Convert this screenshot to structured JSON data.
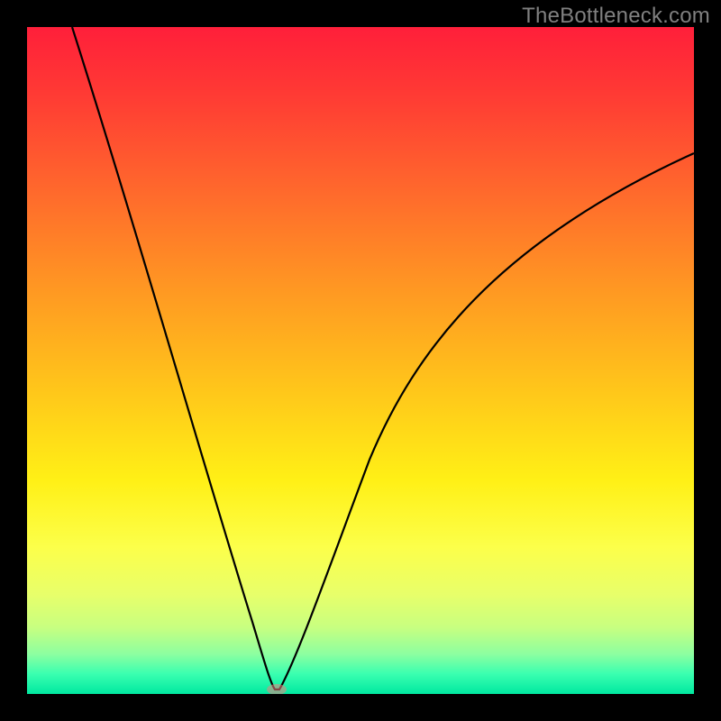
{
  "watermark": "TheBottleneck.com",
  "colors": {
    "frame": "#000000",
    "curve": "#000000",
    "marker": "#f08080",
    "gradient_top": "#ff1f3a",
    "gradient_bottom": "#00e8a0"
  },
  "chart_data": {
    "type": "line",
    "title": "",
    "xlabel": "",
    "ylabel": "",
    "xlim": [
      0,
      100
    ],
    "ylim": [
      0,
      100
    ],
    "x": [
      0,
      5,
      10,
      15,
      20,
      25,
      30,
      33,
      35,
      36,
      37,
      40,
      45,
      50,
      55,
      60,
      65,
      70,
      75,
      80,
      85,
      90,
      95,
      100
    ],
    "y": [
      100,
      86,
      72,
      58,
      44,
      30,
      16,
      6,
      1,
      0,
      1,
      7,
      18,
      28,
      37,
      45,
      52,
      58,
      63,
      68,
      72,
      75,
      78,
      81
    ],
    "annotations": [
      {
        "label": "minimum-marker",
        "x": 36,
        "y": 0
      }
    ]
  }
}
